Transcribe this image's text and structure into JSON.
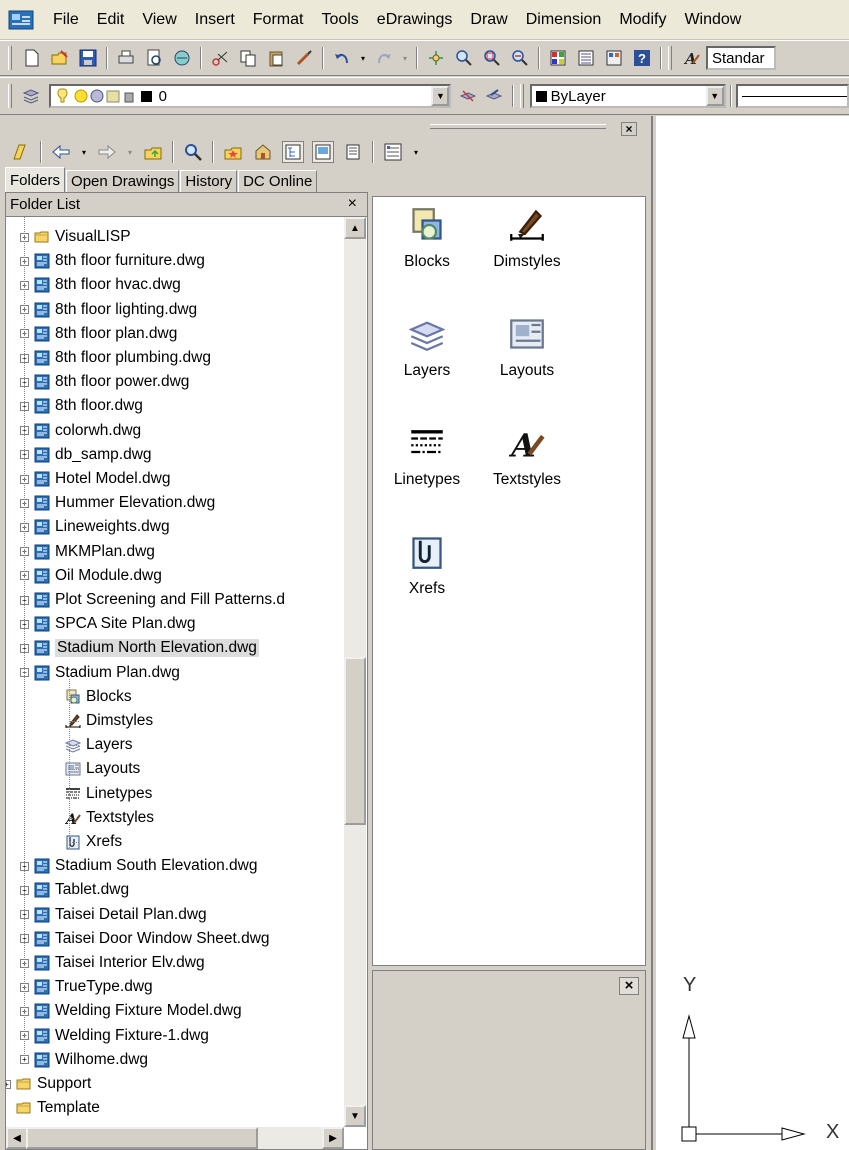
{
  "menubar": {
    "items": [
      "File",
      "Edit",
      "View",
      "Insert",
      "Format",
      "Tools",
      "eDrawings",
      "Draw",
      "Dimension",
      "Modify",
      "Window"
    ]
  },
  "toolbar": {
    "text_style": "Standar",
    "layer_name": "0",
    "color_value": "ByLayer"
  },
  "design_center": {
    "tabs": [
      "Folders",
      "Open Drawings",
      "History",
      "DC Online"
    ],
    "active_tab": "Folders",
    "folder_list_title": "Folder List",
    "close_glyph": "×",
    "tree": [
      {
        "label": "VisualLISP",
        "icon": "folder-icon",
        "expander": "+"
      },
      {
        "label": "8th floor furniture.dwg",
        "icon": "dwg-file-icon",
        "expander": "+"
      },
      {
        "label": "8th floor hvac.dwg",
        "icon": "dwg-file-icon",
        "expander": "+"
      },
      {
        "label": "8th floor lighting.dwg",
        "icon": "dwg-file-icon",
        "expander": "+"
      },
      {
        "label": "8th floor plan.dwg",
        "icon": "dwg-file-icon",
        "expander": "+"
      },
      {
        "label": "8th floor plumbing.dwg",
        "icon": "dwg-file-icon",
        "expander": "+"
      },
      {
        "label": "8th floor power.dwg",
        "icon": "dwg-file-icon",
        "expander": "+"
      },
      {
        "label": "8th floor.dwg",
        "icon": "dwg-file-icon",
        "expander": "+"
      },
      {
        "label": "colorwh.dwg",
        "icon": "dwg-file-icon",
        "expander": "+"
      },
      {
        "label": "db_samp.dwg",
        "icon": "dwg-file-icon",
        "expander": "+"
      },
      {
        "label": "Hotel Model.dwg",
        "icon": "dwg-file-icon",
        "expander": "+"
      },
      {
        "label": "Hummer Elevation.dwg",
        "icon": "dwg-file-icon",
        "expander": "+"
      },
      {
        "label": "Lineweights.dwg",
        "icon": "dwg-file-icon",
        "expander": "+"
      },
      {
        "label": "MKMPlan.dwg",
        "icon": "dwg-file-icon",
        "expander": "+"
      },
      {
        "label": "Oil Module.dwg",
        "icon": "dwg-file-icon",
        "expander": "+"
      },
      {
        "label": "Plot Screening and Fill Patterns.d",
        "icon": "dwg-file-icon",
        "expander": "+"
      },
      {
        "label": "SPCA Site Plan.dwg",
        "icon": "dwg-file-icon",
        "expander": "+"
      },
      {
        "label": "Stadium North Elevation.dwg",
        "icon": "dwg-file-icon",
        "expander": "+",
        "selected": true
      },
      {
        "label": "Stadium Plan.dwg",
        "icon": "dwg-file-icon",
        "expander": "−"
      },
      {
        "label": "Blocks",
        "icon": "blocks-icon",
        "child": true
      },
      {
        "label": "Dimstyles",
        "icon": "dimstyles-icon",
        "child": true
      },
      {
        "label": "Layers",
        "icon": "layers-icon",
        "child": true
      },
      {
        "label": "Layouts",
        "icon": "layouts-icon",
        "child": true
      },
      {
        "label": "Linetypes",
        "icon": "linetypes-icon",
        "child": true
      },
      {
        "label": "Textstyles",
        "icon": "textstyles-icon",
        "child": true
      },
      {
        "label": "Xrefs",
        "icon": "xrefs-icon",
        "child": true
      },
      {
        "label": "Stadium South Elevation.dwg",
        "icon": "dwg-file-icon",
        "expander": "+"
      },
      {
        "label": "Tablet.dwg",
        "icon": "dwg-file-icon",
        "expander": "+"
      },
      {
        "label": "Taisei Detail Plan.dwg",
        "icon": "dwg-file-icon",
        "expander": "+"
      },
      {
        "label": "Taisei Door Window Sheet.dwg",
        "icon": "dwg-file-icon",
        "expander": "+"
      },
      {
        "label": "Taisei Interior Elv.dwg",
        "icon": "dwg-file-icon",
        "expander": "+"
      },
      {
        "label": "TrueType.dwg",
        "icon": "dwg-file-icon",
        "expander": "+"
      },
      {
        "label": "Welding Fixture Model.dwg",
        "icon": "dwg-file-icon",
        "expander": "+"
      },
      {
        "label": "Welding Fixture-1.dwg",
        "icon": "dwg-file-icon",
        "expander": "+"
      },
      {
        "label": "Wilhome.dwg",
        "icon": "dwg-file-icon",
        "expander": "+"
      },
      {
        "label": "Support",
        "icon": "folder-icon",
        "expander": "+",
        "level": 0
      },
      {
        "label": "Template",
        "icon": "folder-icon",
        "level": 0
      }
    ],
    "content_items": [
      {
        "label": "Blocks",
        "icon": "blocks-icon"
      },
      {
        "label": "Dimstyles",
        "icon": "dimstyles-icon"
      },
      {
        "label": "Layers",
        "icon": "layers-icon"
      },
      {
        "label": "Layouts",
        "icon": "layouts-icon"
      },
      {
        "label": "Linetypes",
        "icon": "linetypes-icon"
      },
      {
        "label": "Textstyles",
        "icon": "textstyles-icon"
      },
      {
        "label": "Xrefs",
        "icon": "xrefs-icon"
      }
    ]
  },
  "drawing": {
    "y_axis_label": "Y",
    "x_axis_label": "X"
  },
  "colors": {
    "window_bg": "#d4d0c8",
    "menubar_bg": "#ece9d8",
    "selection_bg": "#dcdcdc",
    "dwg_icon_blue": "#2a6fb7"
  }
}
